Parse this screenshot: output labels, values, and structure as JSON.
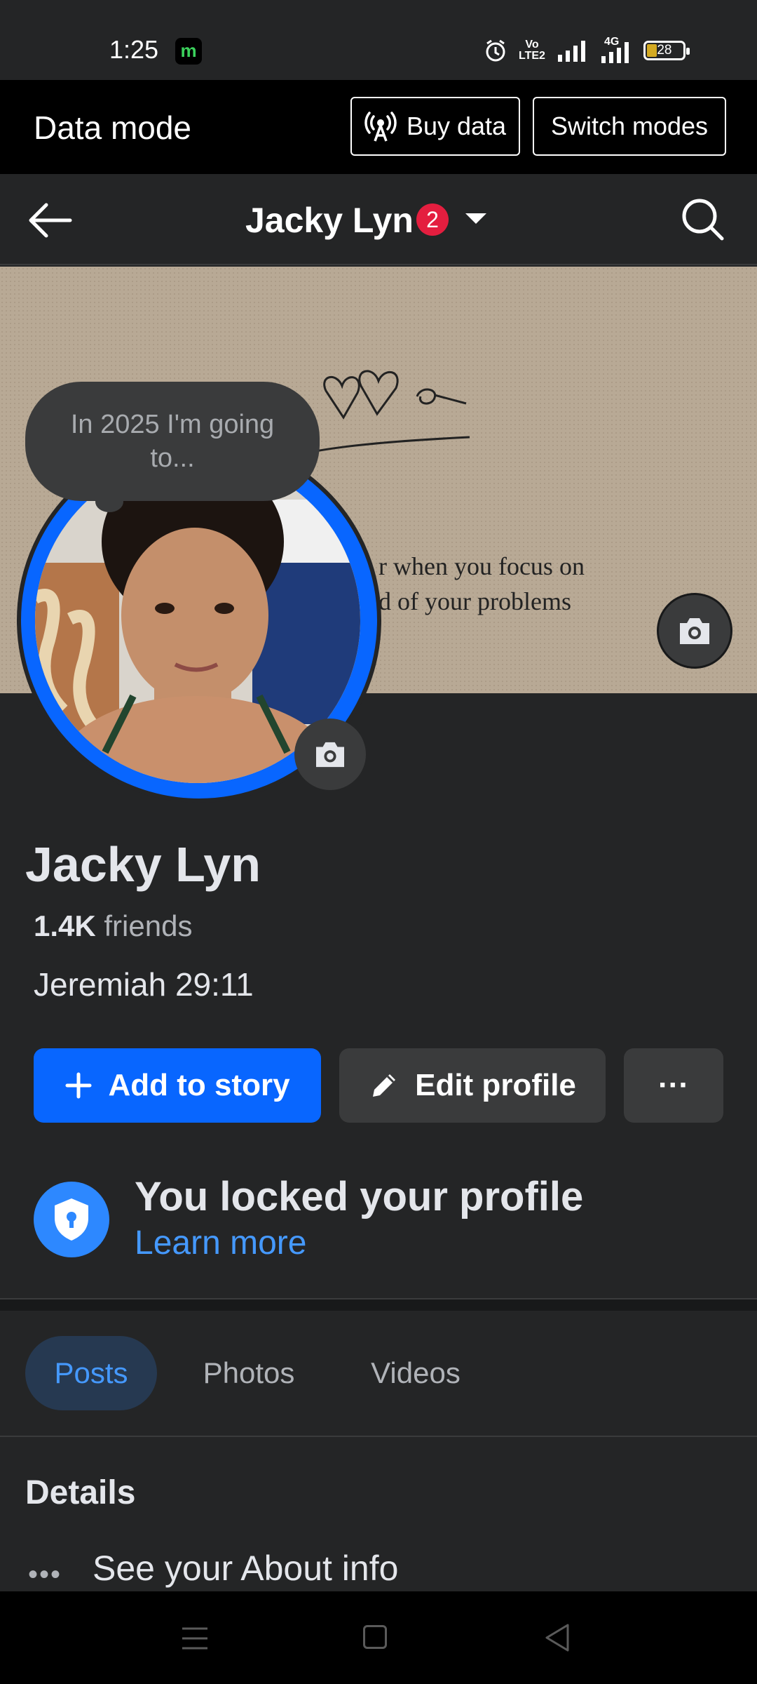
{
  "status_bar": {
    "time": "1:25",
    "app_icon_letter": "m",
    "volte_top": "Vo",
    "volte_bottom": "LTE2",
    "network": "4G",
    "battery": "28"
  },
  "data_mode": {
    "title": "Data mode",
    "buy_label": "Buy data",
    "switch_label": "Switch modes"
  },
  "nav": {
    "title": "Jacky Lyn",
    "badge": "2"
  },
  "cover": {
    "text": "r when you focus on\nd of your problems"
  },
  "bubble": {
    "text": "In 2025 I'm going to..."
  },
  "profile": {
    "name": "Jacky Lyn",
    "friends_count": "1.4K",
    "friends_label": "friends",
    "bio": "Jeremiah 29:11"
  },
  "actions": {
    "add_story": "Add to story",
    "edit_profile": "Edit profile",
    "more": "···"
  },
  "locked": {
    "title": "You locked your profile",
    "link": "Learn more"
  },
  "tabs": [
    "Posts",
    "Photos",
    "Videos"
  ],
  "details": {
    "title": "Details",
    "about": "See your About info"
  },
  "colors": {
    "accent": "#0866ff",
    "link": "#4599ff",
    "badge": "#e41e3f",
    "background": "#242526"
  }
}
